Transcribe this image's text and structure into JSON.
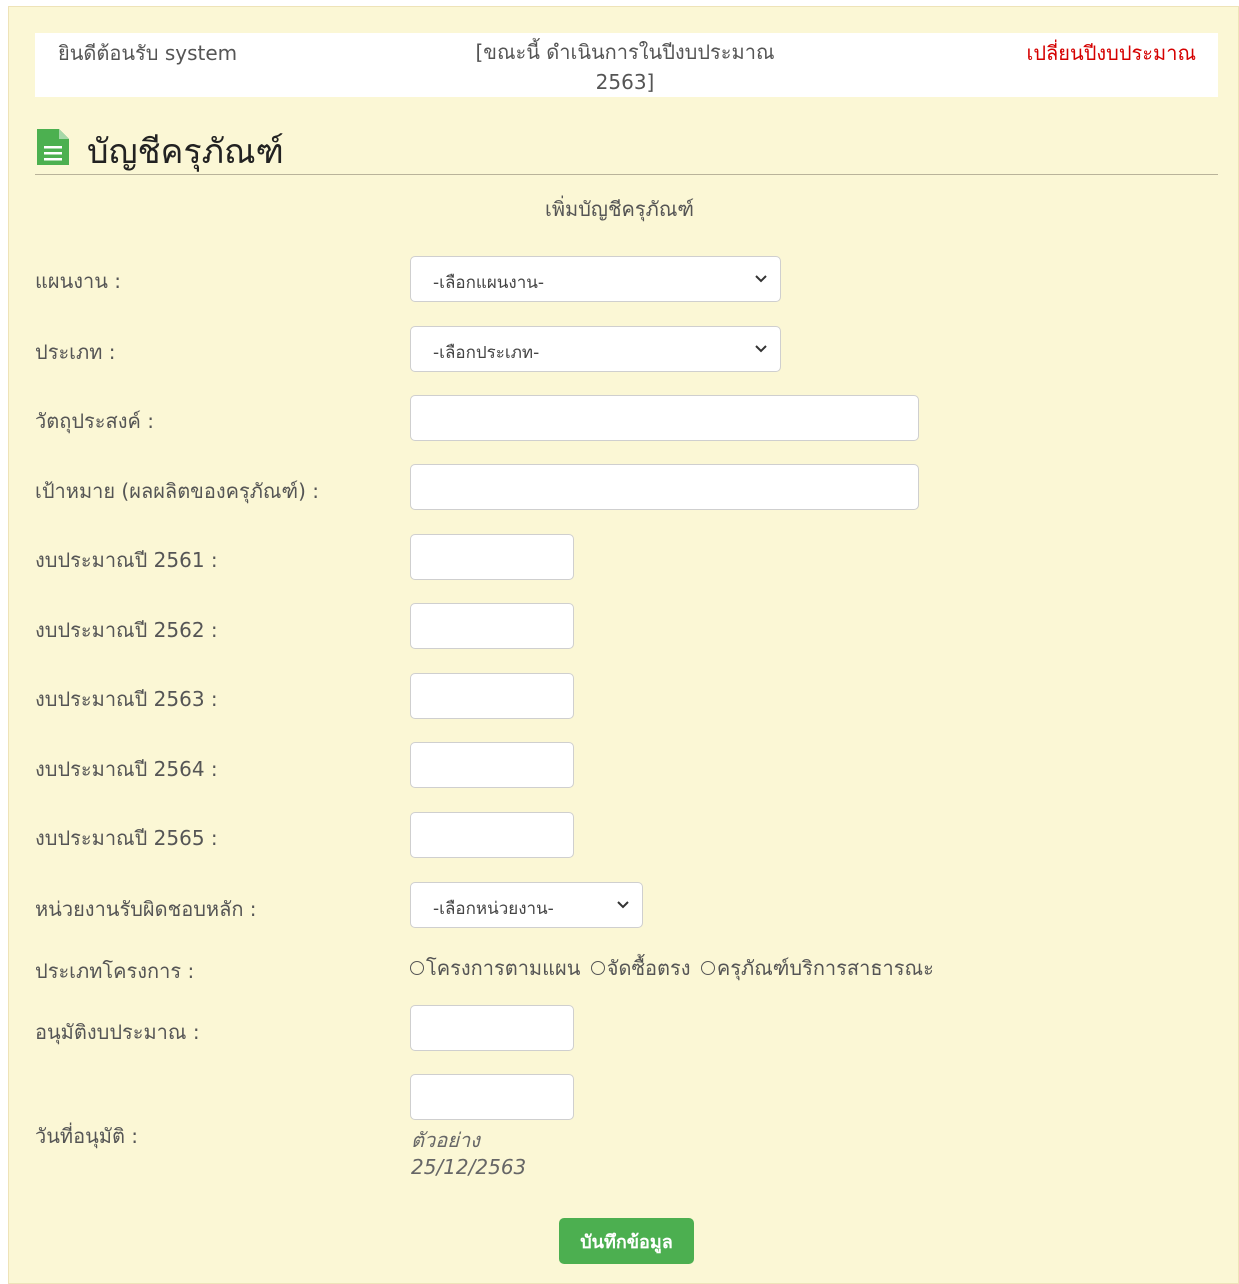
{
  "header": {
    "welcome": "ยินดีต้อนรับ system",
    "status_line1": "[ขณะนี้ ดำเนินการในปีงบประมาณ",
    "status_line2": "2563]",
    "change_year": "เปลี่ยนปีงบประมาณ"
  },
  "page": {
    "title": "บัญชีครุภัณฑ์",
    "form_heading": "เพิ่มบัญชีครุภัณฑ์"
  },
  "form": {
    "plan_label": "แผนงาน :",
    "plan_value": "-เลือกแผนงาน-",
    "type_label": "ประเภท :",
    "type_value": "-เลือกประเภท-",
    "objective_label": "วัตถุประสงค์ :",
    "objective_value": "",
    "target_label": "เป้าหมาย (ผลผลิตของครุภัณฑ์) :",
    "target_value": "",
    "budget_2561_label": "งบประมาณปี 2561 :",
    "budget_2562_label": "งบประมาณปี 2562 :",
    "budget_2563_label": "งบประมาณปี 2563 :",
    "budget_2564_label": "งบประมาณปี 2564 :",
    "budget_2565_label": "งบประมาณปี 2565 :",
    "unit_label": "หน่วยงานรับผิดชอบหลัก :",
    "unit_value": "-เลือกหน่วยงาน-",
    "project_type_label": "ประเภทโครงการ :",
    "project_type_options": [
      "โครงการตามแผน",
      "จัดซื้อตรง",
      "ครุภัณฑ์บริการสาธารณะ"
    ],
    "approved_budget_label": "อนุมัติงบประมาณ :",
    "approval_date_label": "วันที่อนุมัติ :",
    "date_hint_1": "ตัวอย่าง",
    "date_hint_2": "25/12/2563",
    "save_label": "บันทึกข้อมูล"
  },
  "colors": {
    "panel_bg": "#fbf7d5",
    "accent_green": "#4caf50",
    "link_red": "#d50000"
  },
  "icons": {
    "title_icon": "document-icon",
    "select_icon": "chevron-down-icon"
  }
}
